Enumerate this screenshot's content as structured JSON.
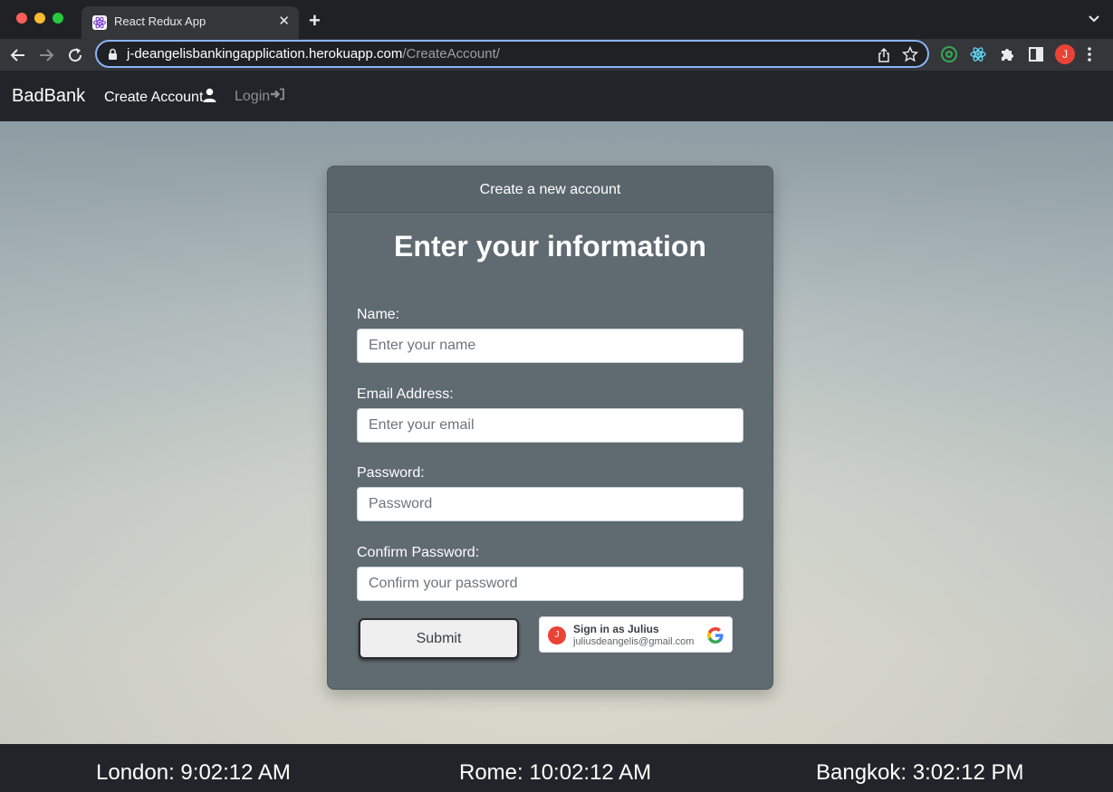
{
  "browser": {
    "tab_title": "React Redux App",
    "url_host": "j-deangelisbankingapplication.herokuapp.com",
    "url_path": "/CreateAccount/",
    "profile_initial": "J",
    "icons": [
      "react-favicon-icon",
      "close-icon",
      "plus-icon",
      "chevron-down-icon",
      "back-arrow-icon",
      "forward-arrow-icon",
      "reload-icon",
      "lock-icon",
      "share-icon",
      "star-icon",
      "extension-green-icon",
      "react-devtools-icon",
      "puzzle-icon",
      "sidebar-icon",
      "kebab-menu-icon"
    ]
  },
  "navbar": {
    "brand": "BadBank",
    "create_account": "Create Account",
    "login": "Login"
  },
  "card": {
    "header": "Create a new account",
    "title": "Enter your information",
    "fields": {
      "name": {
        "label": "Name:",
        "placeholder": "Enter your name"
      },
      "email": {
        "label": "Email Address:",
        "placeholder": "Enter your email"
      },
      "password": {
        "label": "Password:",
        "placeholder": "Password"
      },
      "confirm": {
        "label": "Confirm Password:",
        "placeholder": "Confirm your password"
      }
    },
    "submit_label": "Submit",
    "google_signin": {
      "avatar_initial": "J",
      "title": "Sign in as Julius",
      "email": "juliusdeangelis@gmail.com"
    }
  },
  "footer": {
    "clocks": [
      {
        "text": "London: 9:02:12 AM"
      },
      {
        "text": "Rome: 10:02:12 AM"
      },
      {
        "text": "Bangkok: 3:02:12 PM"
      }
    ]
  },
  "colors": {
    "navbar_bg": "#212529",
    "card_bg": "#5f6a71",
    "focus_ring": "#8ab4f8",
    "profile": "#ea4335"
  }
}
